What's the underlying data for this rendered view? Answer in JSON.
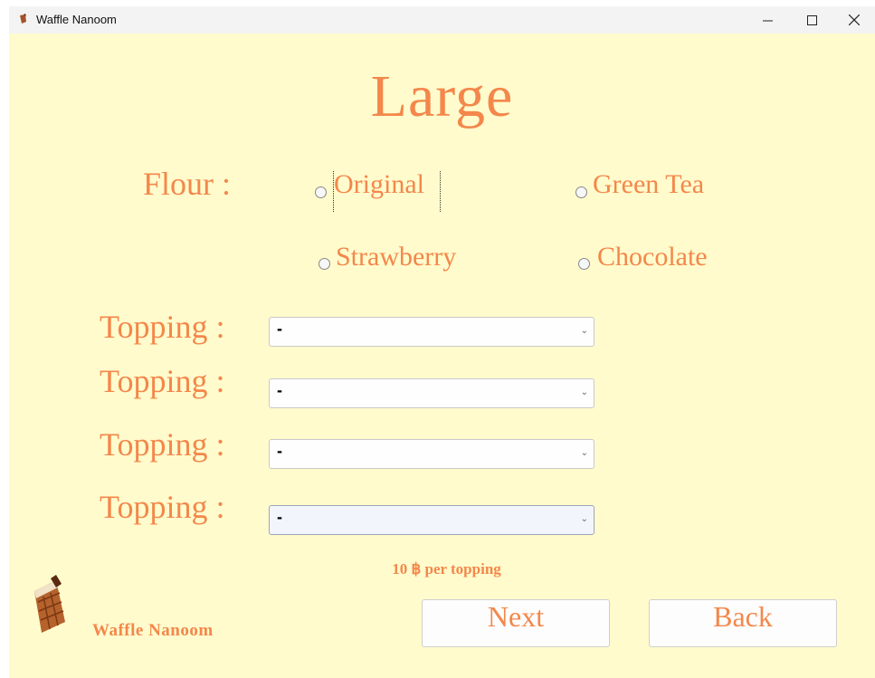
{
  "window": {
    "title": "Waffle Nanoom"
  },
  "heading": "Large",
  "flour": {
    "label": "Flour :",
    "options": [
      "Original",
      "Green Tea",
      "Strawberry",
      "Chocolate"
    ]
  },
  "toppings": {
    "label": "Topping :",
    "selects": [
      {
        "value": "-"
      },
      {
        "value": "-"
      },
      {
        "value": "-"
      },
      {
        "value": "-"
      }
    ]
  },
  "note": "10 ฿ per topping",
  "buttons": {
    "next": "Next",
    "back": "Back"
  },
  "brand": "Waffle Nanoom",
  "colors": {
    "accent": "#f4874b",
    "background": "#fffbcc"
  },
  "icons": {
    "app": "waffle-icon",
    "logo": "waffle-logo-icon"
  }
}
